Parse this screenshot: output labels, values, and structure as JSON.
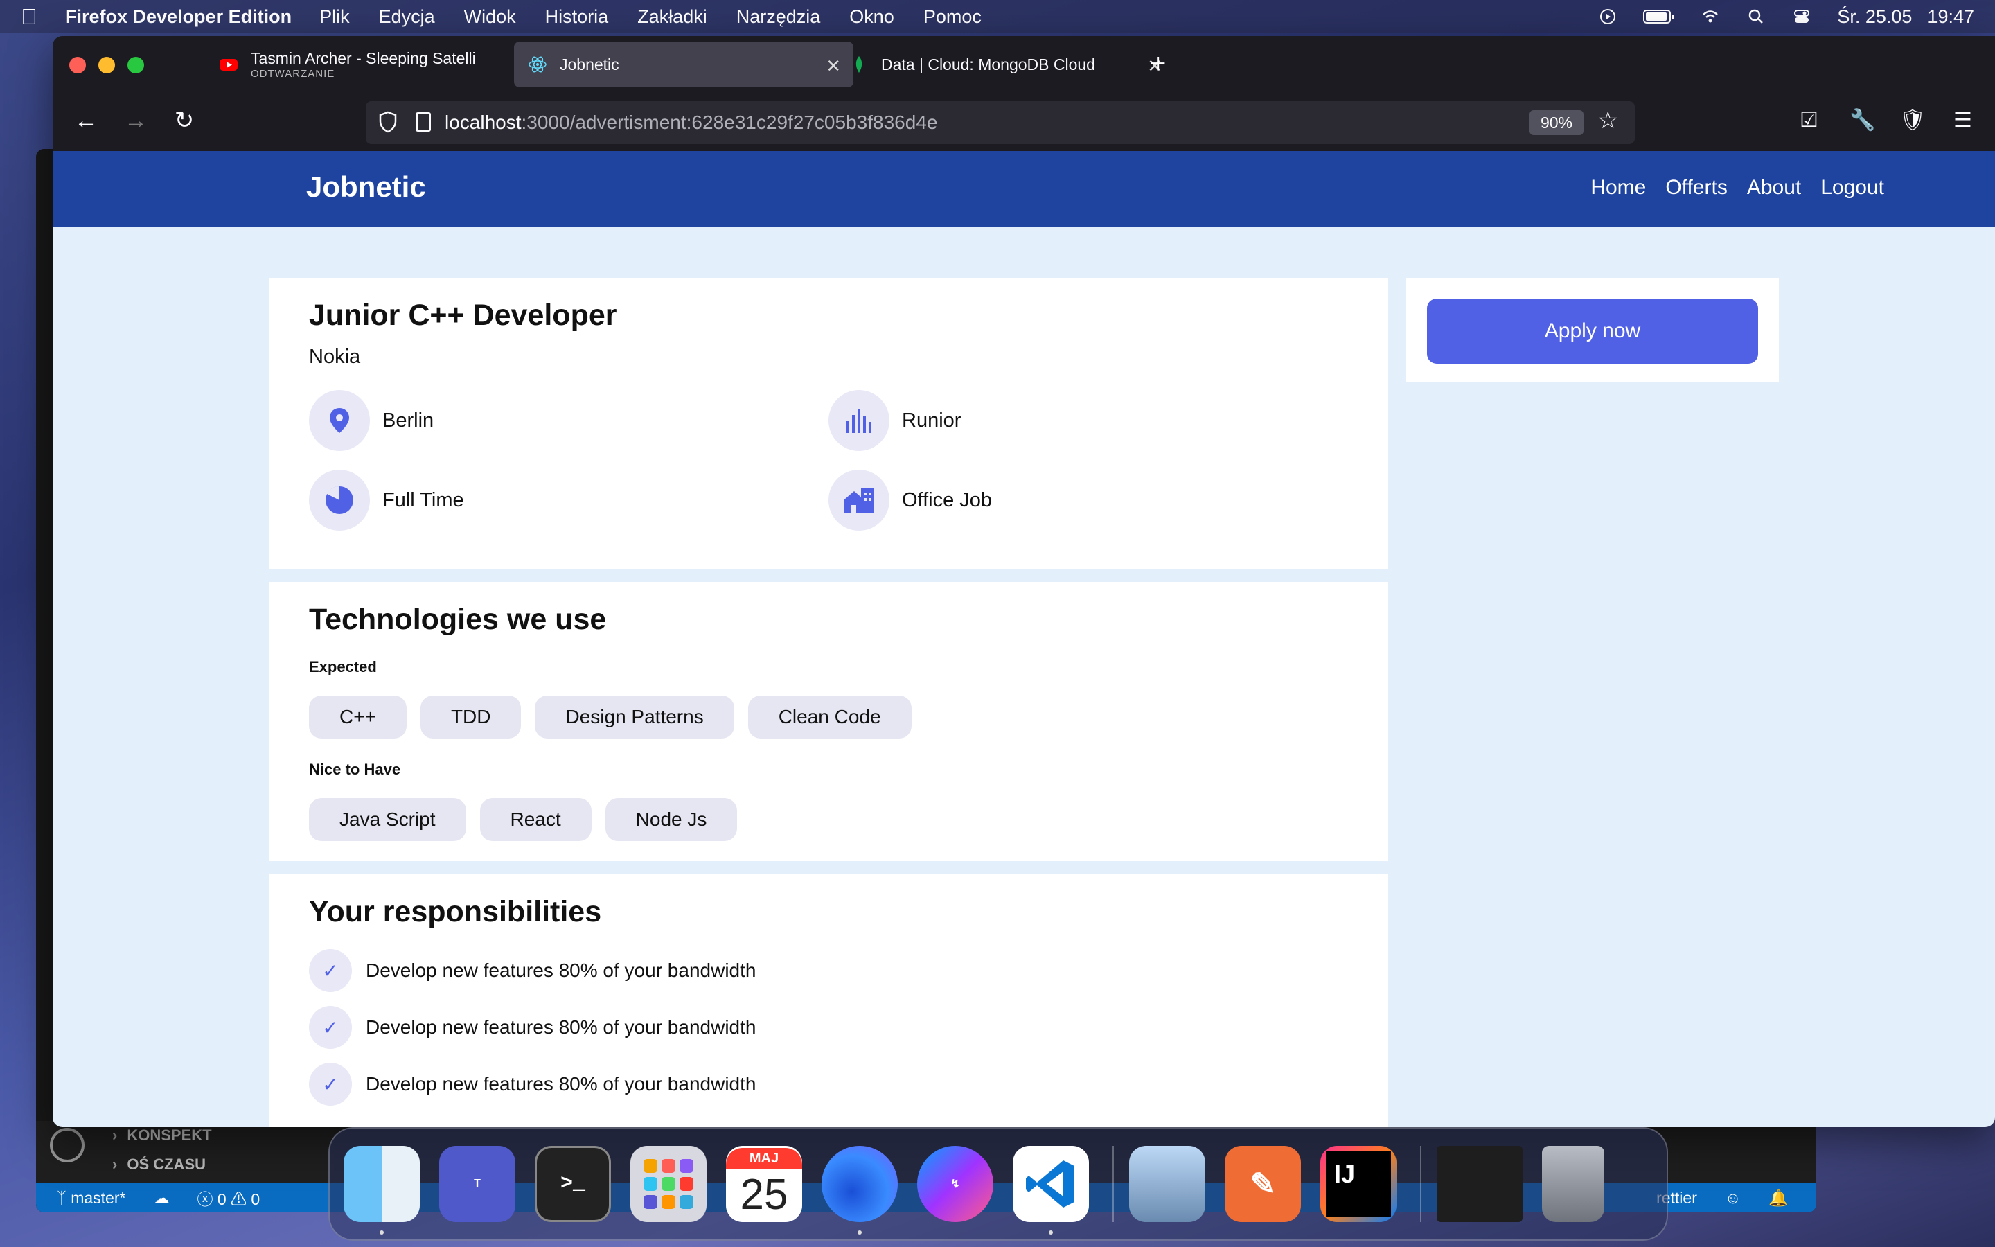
{
  "menubar": {
    "app_name": "Firefox Developer Edition",
    "items": [
      "Plik",
      "Edycja",
      "Widok",
      "Historia",
      "Zakładki",
      "Narzędzia",
      "Okno",
      "Pomoc"
    ],
    "date": "Śr. 25.05",
    "time": "19:47"
  },
  "browser": {
    "tabs": [
      {
        "title": "Tasmin Archer - Sleeping Satelli",
        "subtitle": "ODTWARZANIE"
      },
      {
        "title": "Jobnetic"
      },
      {
        "title": "Data | Cloud: MongoDB Cloud"
      }
    ],
    "url_host": "localhost",
    "url_path": ":3000/advertisment:628e31c29f27c05b3f836d4e",
    "zoom": "90%"
  },
  "site": {
    "brand": "Jobnetic",
    "nav": [
      "Home",
      "Offerts",
      "About",
      "Logout"
    ]
  },
  "job": {
    "title": "Junior C++ Developer",
    "company": "Nokia",
    "location": "Berlin",
    "level": "Runior",
    "employment": "Full Time",
    "workplace": "Office Job"
  },
  "apply": {
    "label": "Apply now"
  },
  "technologies": {
    "title": "Technologies we use",
    "expected_label": "Expected",
    "expected": [
      "C++",
      "TDD",
      "Design Patterns",
      "Clean Code"
    ],
    "nice_label": "Nice to Have",
    "nice": [
      "Java Script",
      "React",
      "Node Js"
    ]
  },
  "responsibilities": {
    "title": "Your responsibilities",
    "items": [
      "Develop new features 80% of your bandwidth",
      "Develop new features 80% of your bandwidth",
      "Develop new features 80% of your bandwidth"
    ]
  },
  "vscode": {
    "outline": [
      "KONSPEKT",
      "OŚ CZASU"
    ],
    "branch": "master*",
    "problems": "0",
    "warnings": "0",
    "prettier": "rettier"
  },
  "dock": {
    "calendar_month": "MAJ",
    "calendar_day": "25",
    "apps": [
      "finder-icon",
      "teams-icon",
      "terminal-icon",
      "launchpad-icon",
      "calendar-icon",
      "firefox-icon",
      "messenger-icon",
      "vscode-icon",
      "preview-icon",
      "postman-icon",
      "intellij-icon",
      "trash-icon"
    ]
  },
  "colors": {
    "header": "#1f44a0",
    "accent": "#5161e6",
    "page_bg": "#e3effa",
    "chip_bg": "#e6e6f3"
  }
}
